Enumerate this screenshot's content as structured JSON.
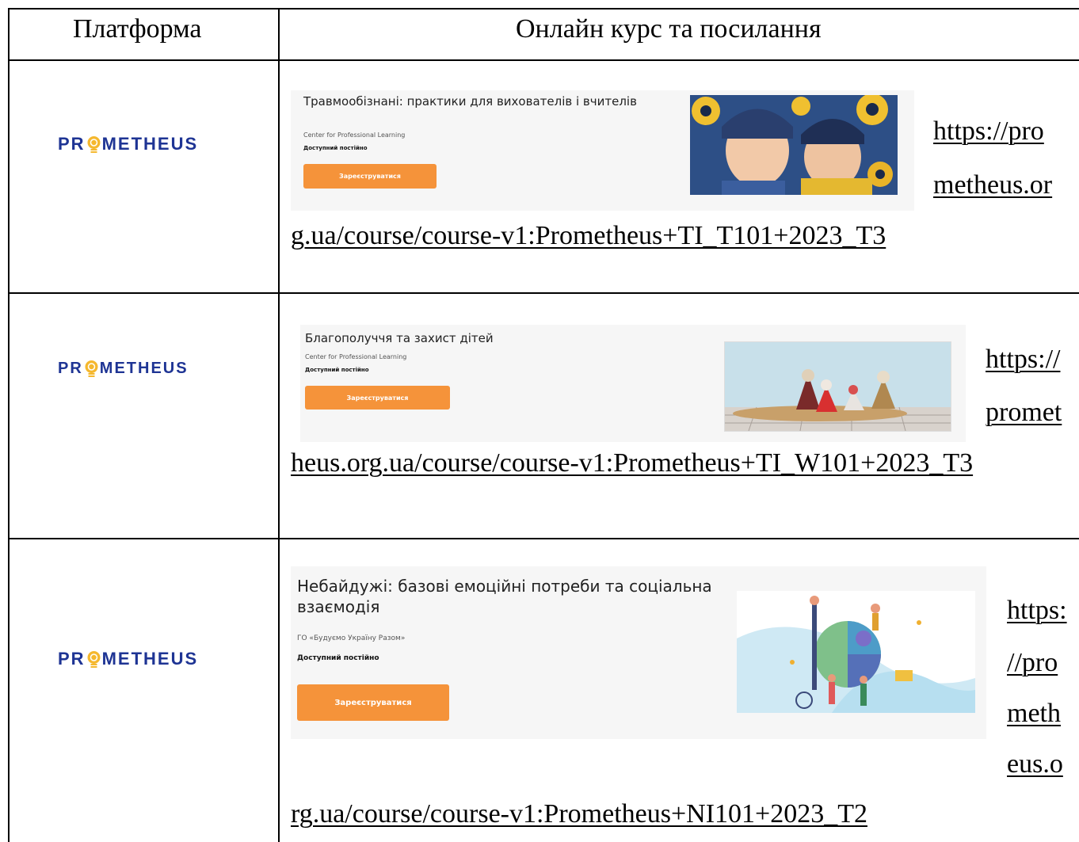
{
  "header": {
    "col1": "Платформа",
    "col2": "Онлайн курс та посилання"
  },
  "rows": [
    {
      "logo": "PROMETHEUS",
      "card": {
        "title": "Травмообізнані: практики для вихователів і вчителів",
        "org": "Center for Professional Learning",
        "availability": "Доступний постійно",
        "button": "Зареєструватися",
        "image": "children-in-knit-hats-image"
      },
      "link_parts": [
        "https://pro",
        "metheus.or",
        "g.ua/course/course-v1:Prometheus+TI_T101+2023_T3"
      ]
    },
    {
      "logo": "PROMETHEUS",
      "card": {
        "title": "Благополуччя та захист дітей",
        "org": "Center for Professional Learning",
        "availability": "Доступний постійно",
        "button": "Зареєструватися",
        "image": "motanka-dolls-image"
      },
      "link_parts": [
        "https://",
        "promet",
        "heus.org.ua/course/course-v1:Prometheus+TI_W101+2023_T3"
      ]
    },
    {
      "logo": "PROMETHEUS",
      "card": {
        "title": "Небайдужі: базові емоційні потреби та соціальна взаємодія",
        "org": "ГО «Будуємо Україну Разом»",
        "availability": "Доступний постійно",
        "button": "Зареєструватися",
        "image": "puzzle-people-illustration"
      },
      "link_parts": [
        "https:",
        "//pro",
        "meth",
        "eus.o",
        "rg.ua/course/course-v1:Prometheus+NI101+2023_T2"
      ]
    }
  ],
  "colors": {
    "logo_blue": "#1e3494",
    "logo_bulb": "#f5b82e",
    "button_orange": "#f5933a"
  }
}
